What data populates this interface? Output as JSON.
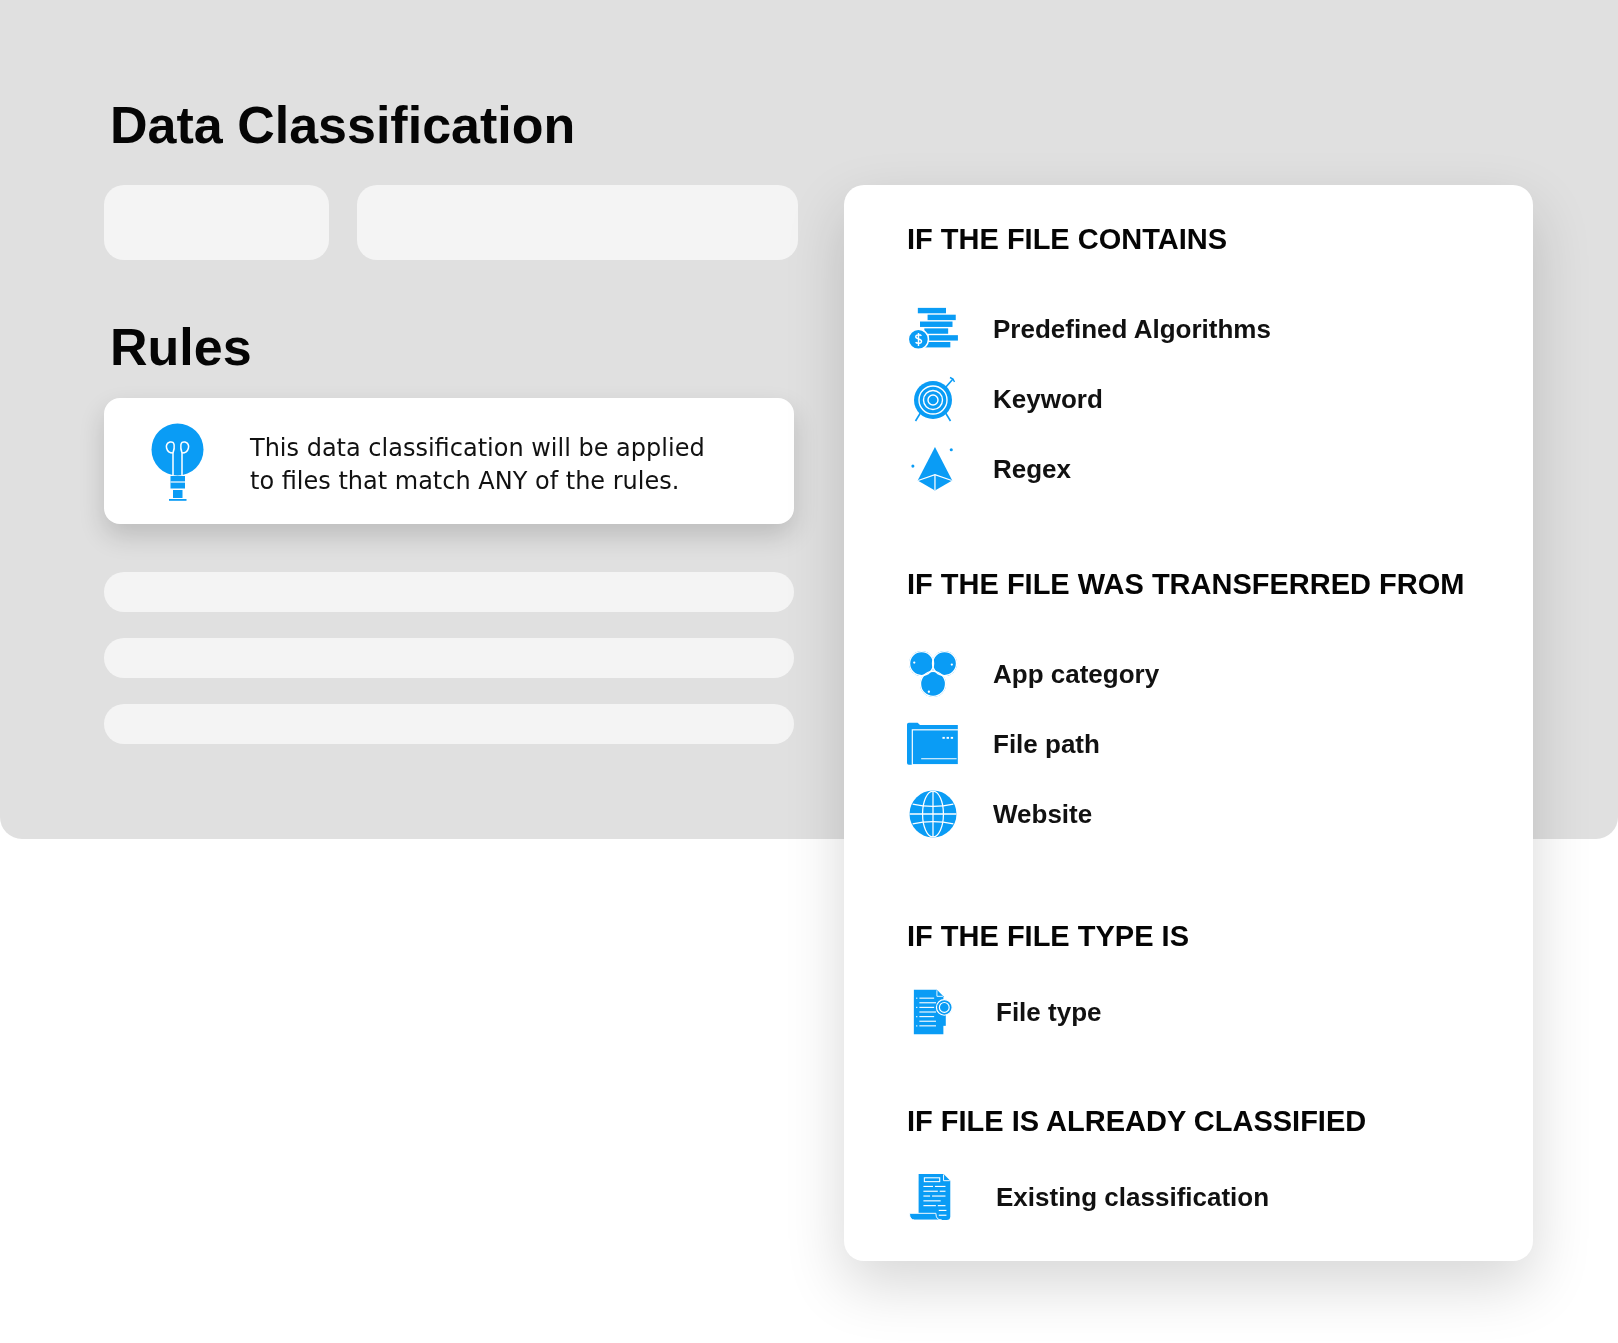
{
  "page": {
    "title": "Data Classification"
  },
  "rules": {
    "title": "Rules",
    "notice": "This data classification will be applied to files that match ANY of the rules."
  },
  "condition_groups": [
    {
      "heading": "IF THE FILE CONTAINS",
      "options": [
        {
          "label": "Predefined Algorithms",
          "kind": "algorithm"
        },
        {
          "label": "Keyword",
          "kind": "keyword"
        },
        {
          "label": "Regex",
          "kind": "regex"
        }
      ]
    },
    {
      "heading": "IF THE FILE WAS TRANSFERRED FROM",
      "options": [
        {
          "label": "App category",
          "kind": "app"
        },
        {
          "label": "File path",
          "kind": "path"
        },
        {
          "label": "Website",
          "kind": "website"
        }
      ]
    },
    {
      "heading": "IF THE FILE TYPE IS",
      "options": [
        {
          "label": "File type",
          "kind": "filetype"
        }
      ]
    },
    {
      "heading": "IF FILE IS ALREADY CLASSIFIED",
      "options": [
        {
          "label": "Existing classification",
          "kind": "classification"
        }
      ]
    }
  ]
}
